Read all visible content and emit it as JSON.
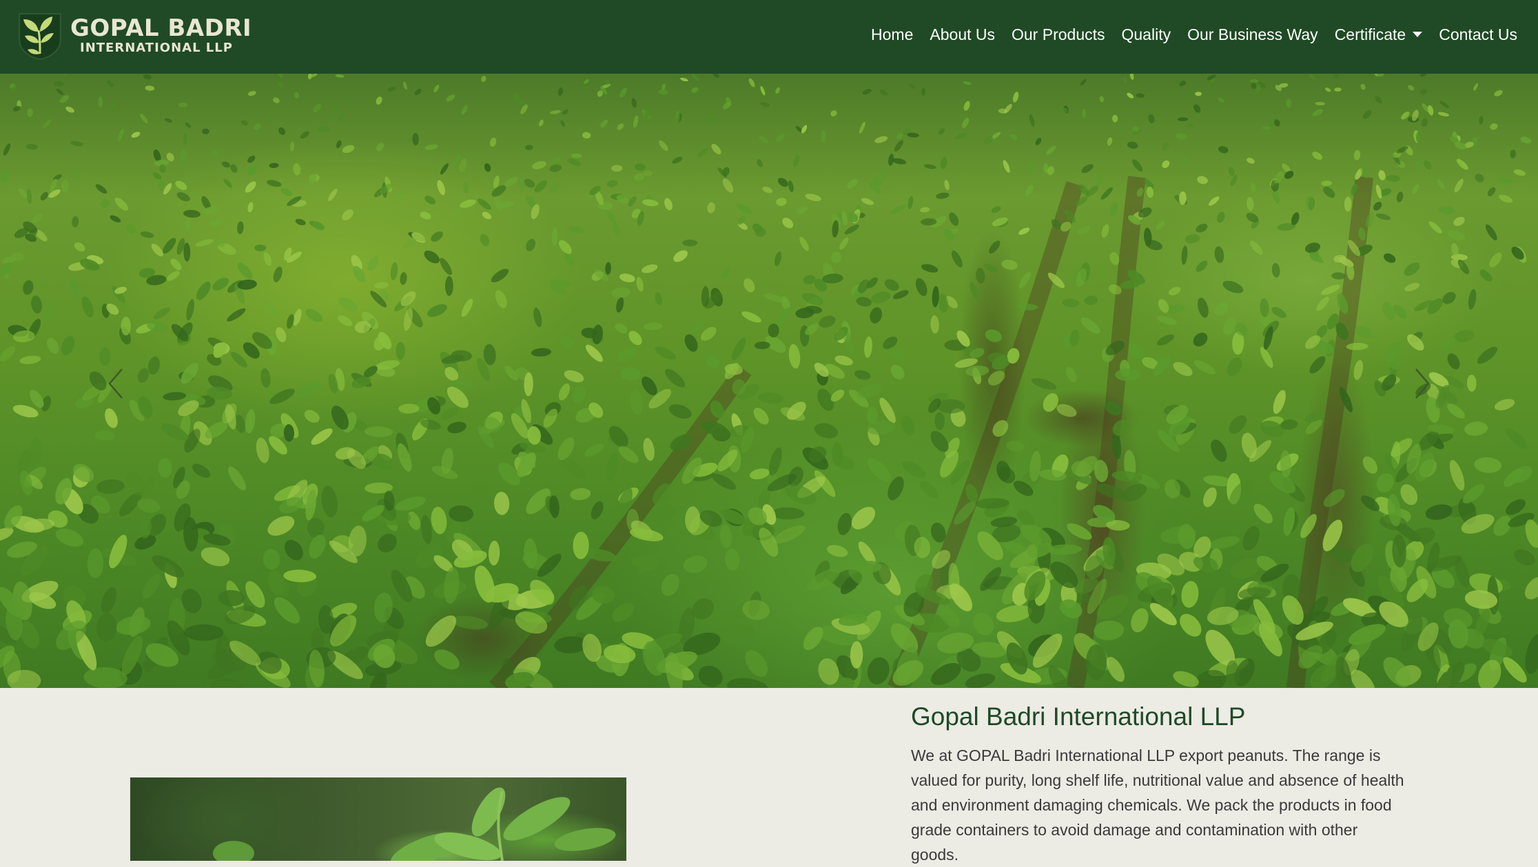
{
  "brand": {
    "line1": "GOPAL BADRI",
    "line2": "INTERNATIONAL LLP",
    "logo_icon": "leaf-shield-icon"
  },
  "nav": {
    "items": [
      {
        "label": "Home"
      },
      {
        "label": "About Us"
      },
      {
        "label": "Our Products"
      },
      {
        "label": "Quality"
      },
      {
        "label": "Our Business Way"
      },
      {
        "label": "Certificate"
      },
      {
        "label": "Contact Us"
      }
    ]
  },
  "hero": {
    "prev_icon": "chevron-left-icon",
    "next_icon": "chevron-right-icon"
  },
  "about": {
    "title": "Gopal Badri International LLP",
    "text": "We at GOPAL Badri International LLP export peanuts. The range is valued for purity, long shelf life, nutritional value and absence of health and environment damaging chemicals. We pack the products in food grade containers to avoid damage and contamination with other goods."
  },
  "colors": {
    "navbar_bg": "#1f4a25",
    "page_bg": "#ecebe4",
    "title_green": "#1f4a25",
    "body_text": "#3a3a3a"
  }
}
